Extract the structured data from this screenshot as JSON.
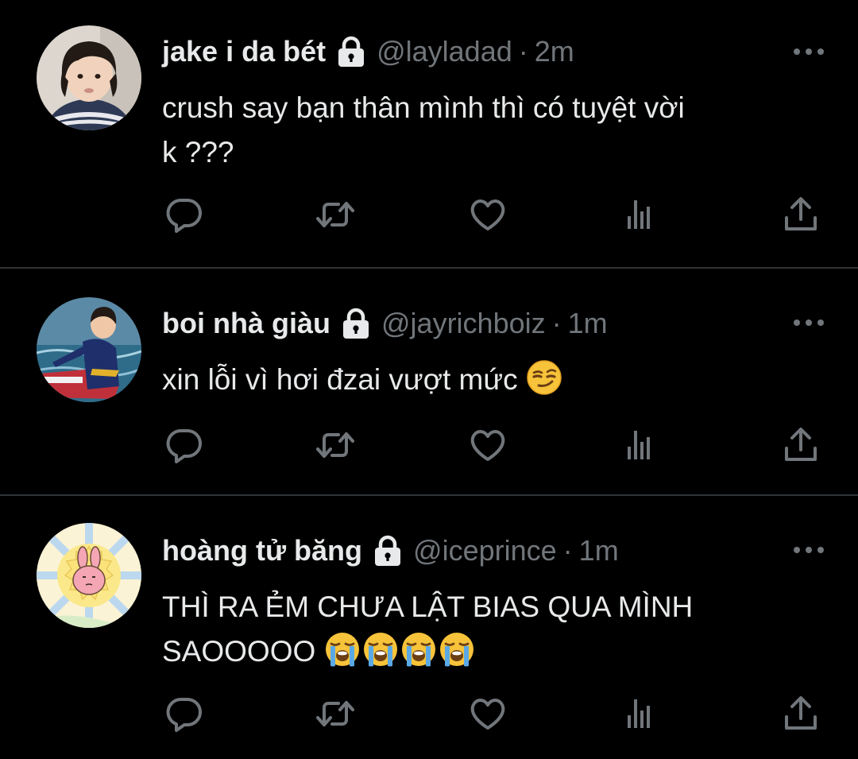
{
  "tweets": [
    {
      "display_name": "jake i da bét",
      "handle": "@layladad",
      "separator": "·",
      "time": "2m",
      "text": "crush say bạn thân mình thì có tuyệt vời\nk ???",
      "emoji": [],
      "avatar": "avatar-boy-portrait"
    },
    {
      "display_name": "boi nhà giàu",
      "handle": "@jayrichboiz",
      "separator": "·",
      "time": "1m",
      "text": "xin lỗi vì hơi đzai vượt mức ",
      "emoji": [
        "smirking-face-emoji"
      ],
      "avatar": "avatar-boy-jetski"
    },
    {
      "display_name": "hoàng tử băng",
      "handle": "@iceprince",
      "separator": "·",
      "time": "1m",
      "text": "THÌ RA ẺM CHƯA LẬT BIAS QUA MÌNH\nSAOOOOO ",
      "emoji": [
        "loudly-crying-face-emoji",
        "loudly-crying-face-emoji",
        "loudly-crying-face-emoji",
        "loudly-crying-face-emoji"
      ],
      "avatar": "avatar-cartoon-bunny"
    }
  ],
  "icons": {
    "lock": "lock-icon",
    "more": "more-icon",
    "reply": "reply-icon",
    "retweet": "retweet-icon",
    "like": "like-icon",
    "views": "views-icon",
    "share": "share-icon"
  },
  "colors": {
    "background": "#000000",
    "text_primary": "#e7e9ea",
    "text_secondary": "#71767b",
    "divider": "#2f3336"
  }
}
